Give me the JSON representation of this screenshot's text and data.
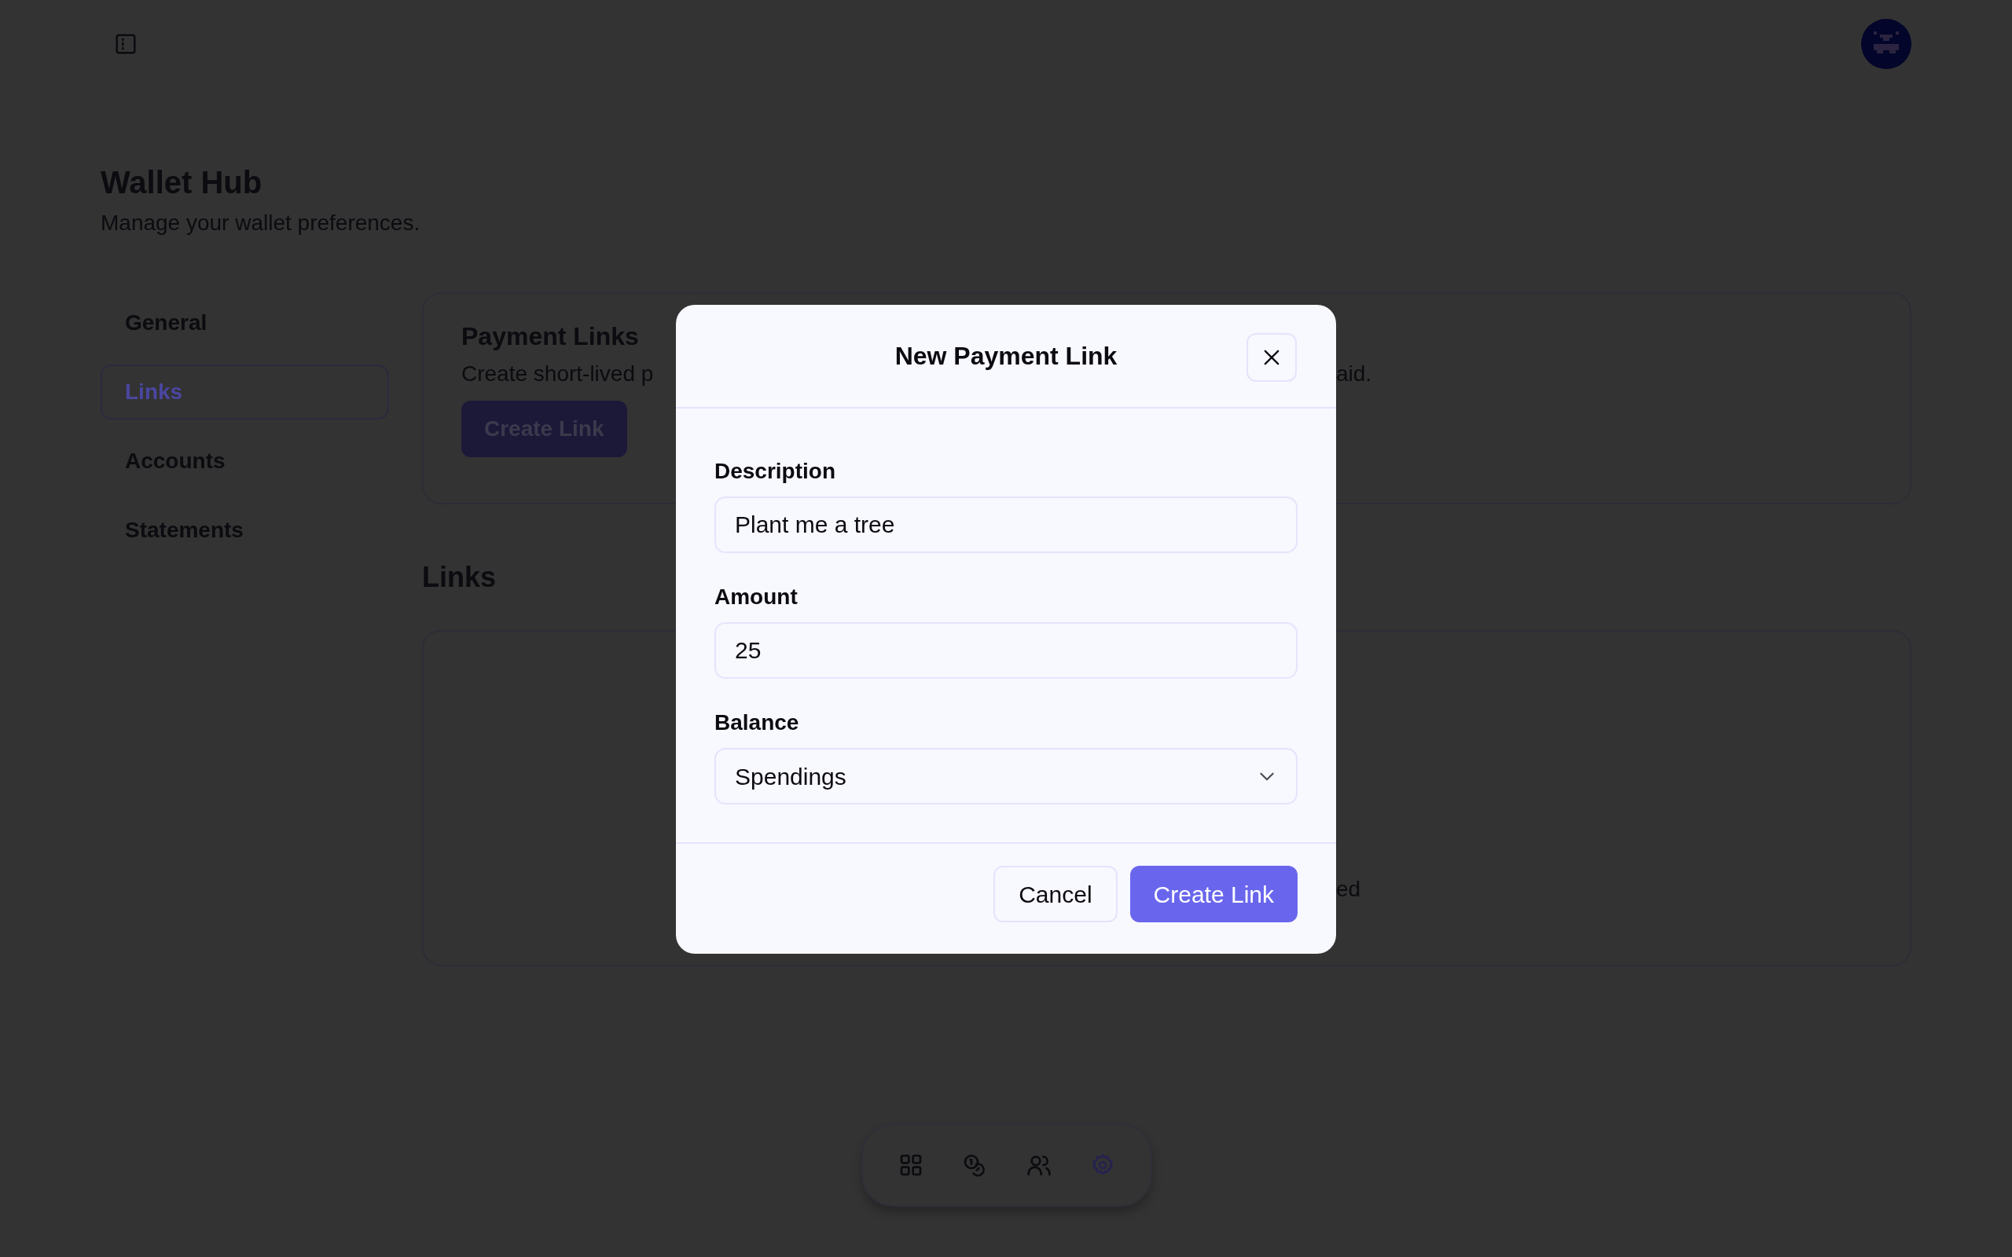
{
  "header": {
    "title": "Wallet Hub",
    "subtitle": "Manage your wallet preferences."
  },
  "sidebar": {
    "items": [
      {
        "label": "General",
        "selected": false
      },
      {
        "label": "Links",
        "selected": true
      },
      {
        "label": "Accounts",
        "selected": false
      },
      {
        "label": "Statements",
        "selected": false
      }
    ]
  },
  "payment_links_card": {
    "title": "Payment Links",
    "description_parts": [
      "Create short-lived p",
      "aid."
    ],
    "button": "Create Link"
  },
  "links_section": {
    "title": "Links",
    "empty_text_part": "ed"
  },
  "bottom_nav": {
    "items": [
      {
        "kind": "grid",
        "selected": false
      },
      {
        "kind": "coins",
        "selected": false
      },
      {
        "kind": "users",
        "selected": false
      },
      {
        "kind": "settings",
        "selected": true
      }
    ]
  },
  "modal": {
    "title": "New Payment Link",
    "fields": [
      {
        "label": "Description",
        "kind": "text",
        "value": "Plant me a tree"
      },
      {
        "label": "Amount",
        "kind": "text",
        "value": "25"
      },
      {
        "label": "Balance",
        "kind": "select",
        "value": "Spendings"
      }
    ],
    "buttons": [
      {
        "label": "Cancel",
        "kind": "secondary"
      },
      {
        "label": "Create Link",
        "kind": "primary"
      }
    ]
  }
}
